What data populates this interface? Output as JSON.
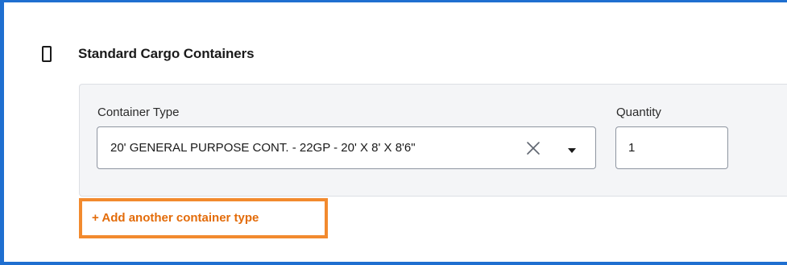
{
  "section": {
    "title": "Standard Cargo Containers",
    "icon": "container-icon"
  },
  "fields": {
    "container_type": {
      "label": "Container Type",
      "value": "20' GENERAL PURPOSE CONT. - 22GP - 20' X 8' X 8'6\"",
      "clear_icon": "close-icon",
      "dropdown_icon": "chevron-down-icon"
    },
    "quantity": {
      "label": "Quantity",
      "value": "1"
    }
  },
  "actions": {
    "add_container_type": "+ Add another container type"
  },
  "colors": {
    "frame_border": "#1f6fd0",
    "accent_orange": "#e36c0a",
    "highlight_orange": "#f28a2e",
    "panel_background": "#f4f5f7"
  }
}
